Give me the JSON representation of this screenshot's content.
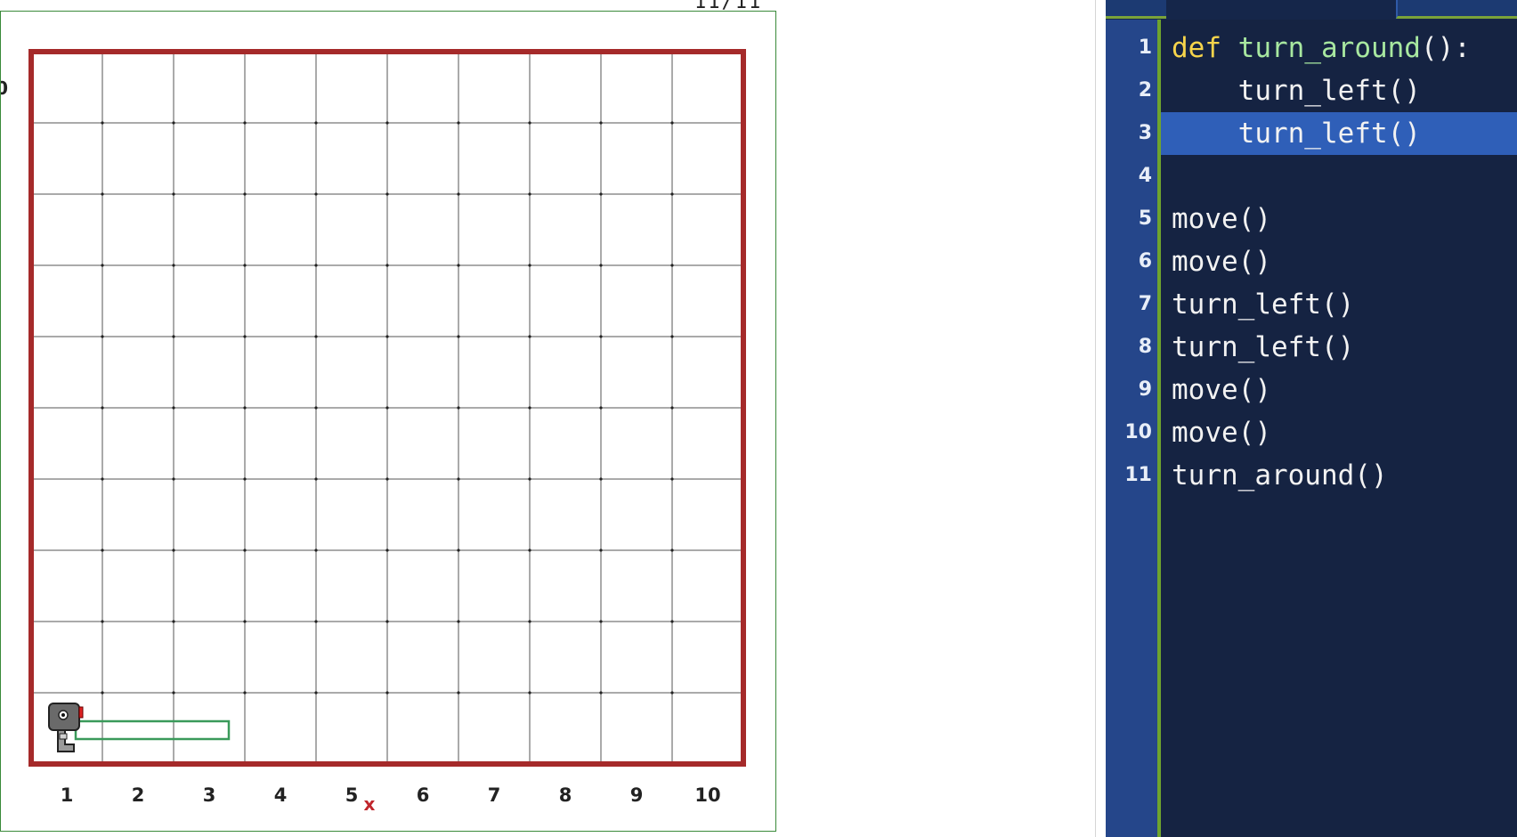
{
  "world": {
    "axis_x_labels": [
      "1",
      "2",
      "3",
      "4",
      "5",
      "6",
      "7",
      "8",
      "9",
      "10"
    ],
    "axis_x_name": "x",
    "axis_y_label_partial": "0",
    "robot": {
      "column": 1,
      "row": 1,
      "icon": "robot-icon"
    },
    "trace_colors": {
      "wall": "#a52a2a",
      "trace": "#3a9a5a",
      "grid": "#555555"
    }
  },
  "editor": {
    "highlighted_line": 3,
    "lines": [
      {
        "num": "1",
        "parts": [
          {
            "t": "def",
            "c": "kw"
          },
          {
            "t": " ",
            "c": ""
          },
          {
            "t": "turn_around",
            "c": "fn"
          },
          {
            "t": "():",
            "c": ""
          }
        ]
      },
      {
        "num": "2",
        "parts": [
          {
            "t": "    turn_left()",
            "c": ""
          }
        ]
      },
      {
        "num": "3",
        "parts": [
          {
            "t": "    turn_left()",
            "c": ""
          }
        ]
      },
      {
        "num": "4",
        "parts": [
          {
            "t": "",
            "c": ""
          }
        ]
      },
      {
        "num": "5",
        "parts": [
          {
            "t": "move()",
            "c": ""
          }
        ]
      },
      {
        "num": "6",
        "parts": [
          {
            "t": "move()",
            "c": ""
          }
        ]
      },
      {
        "num": "7",
        "parts": [
          {
            "t": "turn_left()",
            "c": ""
          }
        ]
      },
      {
        "num": "8",
        "parts": [
          {
            "t": "turn_left()",
            "c": ""
          }
        ]
      },
      {
        "num": "9",
        "parts": [
          {
            "t": "move()",
            "c": ""
          }
        ]
      },
      {
        "num": "10",
        "parts": [
          {
            "t": "move()",
            "c": ""
          }
        ]
      },
      {
        "num": "11",
        "parts": [
          {
            "t": "turn_around()",
            "c": ""
          }
        ]
      }
    ],
    "colors": {
      "background": "#152342",
      "gutter": "#25468a",
      "highlight": "#2f5fb8",
      "keyword": "#f6d44b",
      "function_name": "#a8e8a0"
    }
  },
  "status": {
    "progress_text": "11/11"
  }
}
